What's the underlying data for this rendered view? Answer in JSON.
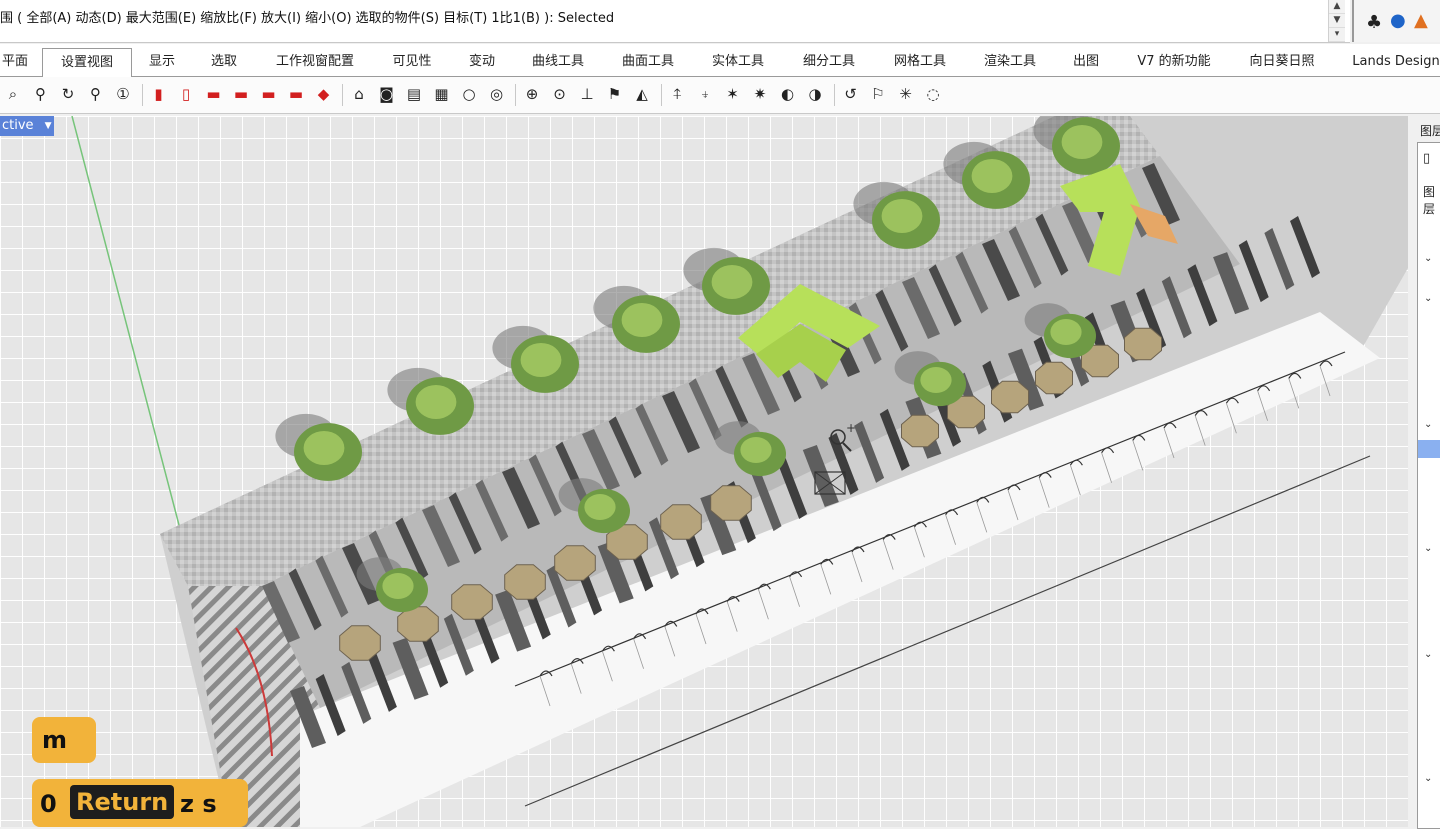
{
  "command_line": {
    "prompt": "围 ( 全部(A)  动态(D)  最大范围(E)  缩放比(F)  放大(I)  缩小(O)  选取的物件(S)  目标(T)  1比1(B) ):   Selected"
  },
  "tabs": [
    {
      "label": "平面"
    },
    {
      "label": "设置视图"
    },
    {
      "label": "显示"
    },
    {
      "label": "选取"
    },
    {
      "label": "工作视窗配置"
    },
    {
      "label": "可见性"
    },
    {
      "label": "变动"
    },
    {
      "label": "曲线工具"
    },
    {
      "label": "曲面工具"
    },
    {
      "label": "实体工具"
    },
    {
      "label": "细分工具"
    },
    {
      "label": "网格工具"
    },
    {
      "label": "渲染工具"
    },
    {
      "label": "出图"
    },
    {
      "label": "V7 的新功能"
    },
    {
      "label": "向日葵日照"
    },
    {
      "label": "Lands Design"
    }
  ],
  "active_tab": "设置视图",
  "toolbar_icons": [
    "zoom-window-icon",
    "zoom-extents-icon",
    "rotate-view-icon",
    "zoom-out-icon",
    "zoom-1to1-icon",
    "car-front-icon",
    "car-back-icon",
    "car-left-icon",
    "car-right-icon",
    "car-top-icon",
    "car-persp-icon",
    "car-3d-icon",
    "named-view-icon",
    "camera-icon",
    "print-view-icon",
    "background-bitmap-icon",
    "light-icon",
    "two-point-persp-icon",
    "target-icon",
    "camera-target-icon",
    "camera-up-icon",
    "flag-icon",
    "lens-icon",
    "pan-up-icon",
    "pan-down-icon",
    "tilt-left-icon",
    "tilt-right-icon",
    "swivel-left-icon",
    "swivel-right-icon",
    "undo-view-icon",
    "walkabout-icon",
    "sun-icon",
    "crosshair-icon"
  ],
  "viewport": {
    "label": "ctive",
    "label_arrow": "▼"
  },
  "key_overlay": {
    "row1": "m",
    "row2_a": "0",
    "row2_b": "Return",
    "row2_c": "z s"
  },
  "right_panel": {
    "title": "图层",
    "row_label": "图层"
  },
  "colors": {
    "accent": "#5a82d8",
    "key_overlay": "#f2b33a",
    "selection": "#8ab0f0",
    "lawn_green": "#b7e05a"
  }
}
